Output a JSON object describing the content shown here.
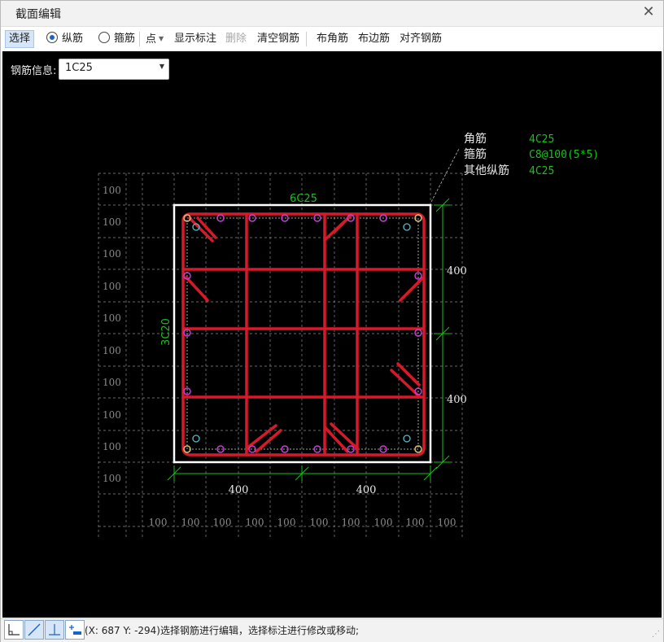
{
  "window": {
    "title": "截面编辑",
    "close_icon": "✕"
  },
  "toolbar": {
    "select": "选择",
    "longitudinal": "纵筋",
    "stirrup": "箍筋",
    "point": "点",
    "show_annotation": "显示标注",
    "delete": "删除",
    "clear_rebar": "清空钢筋",
    "place_corner": "布角筋",
    "place_edge": "布边筋",
    "align_rebar": "对齐钢筋"
  },
  "rebar_info": {
    "label": "钢筋信息:",
    "selected": "1C25"
  },
  "drawing": {
    "grid_label": "100",
    "top_rebar": "6C25",
    "side_rebar": "3C20",
    "dim_right_1": "400",
    "dim_right_2": "400",
    "dim_bottom_1": "400",
    "dim_bottom_2": "400",
    "legend": {
      "corner_label": "角筋",
      "corner_value": "4C25",
      "stirrup_label": "箍筋",
      "stirrup_value": "C8@100(5*5)",
      "other_label": "其他纵筋",
      "other_value": "4C25"
    }
  },
  "status": {
    "text": "(X: 687 Y: -294)选择钢筋进行编辑，选择标注进行修改或移动;"
  },
  "colors": {
    "rebar": "#d8192a",
    "dim": "#19c019",
    "grid": "#8a8a8a",
    "bar_dot": "#c040d0",
    "section": "#ffffff"
  }
}
